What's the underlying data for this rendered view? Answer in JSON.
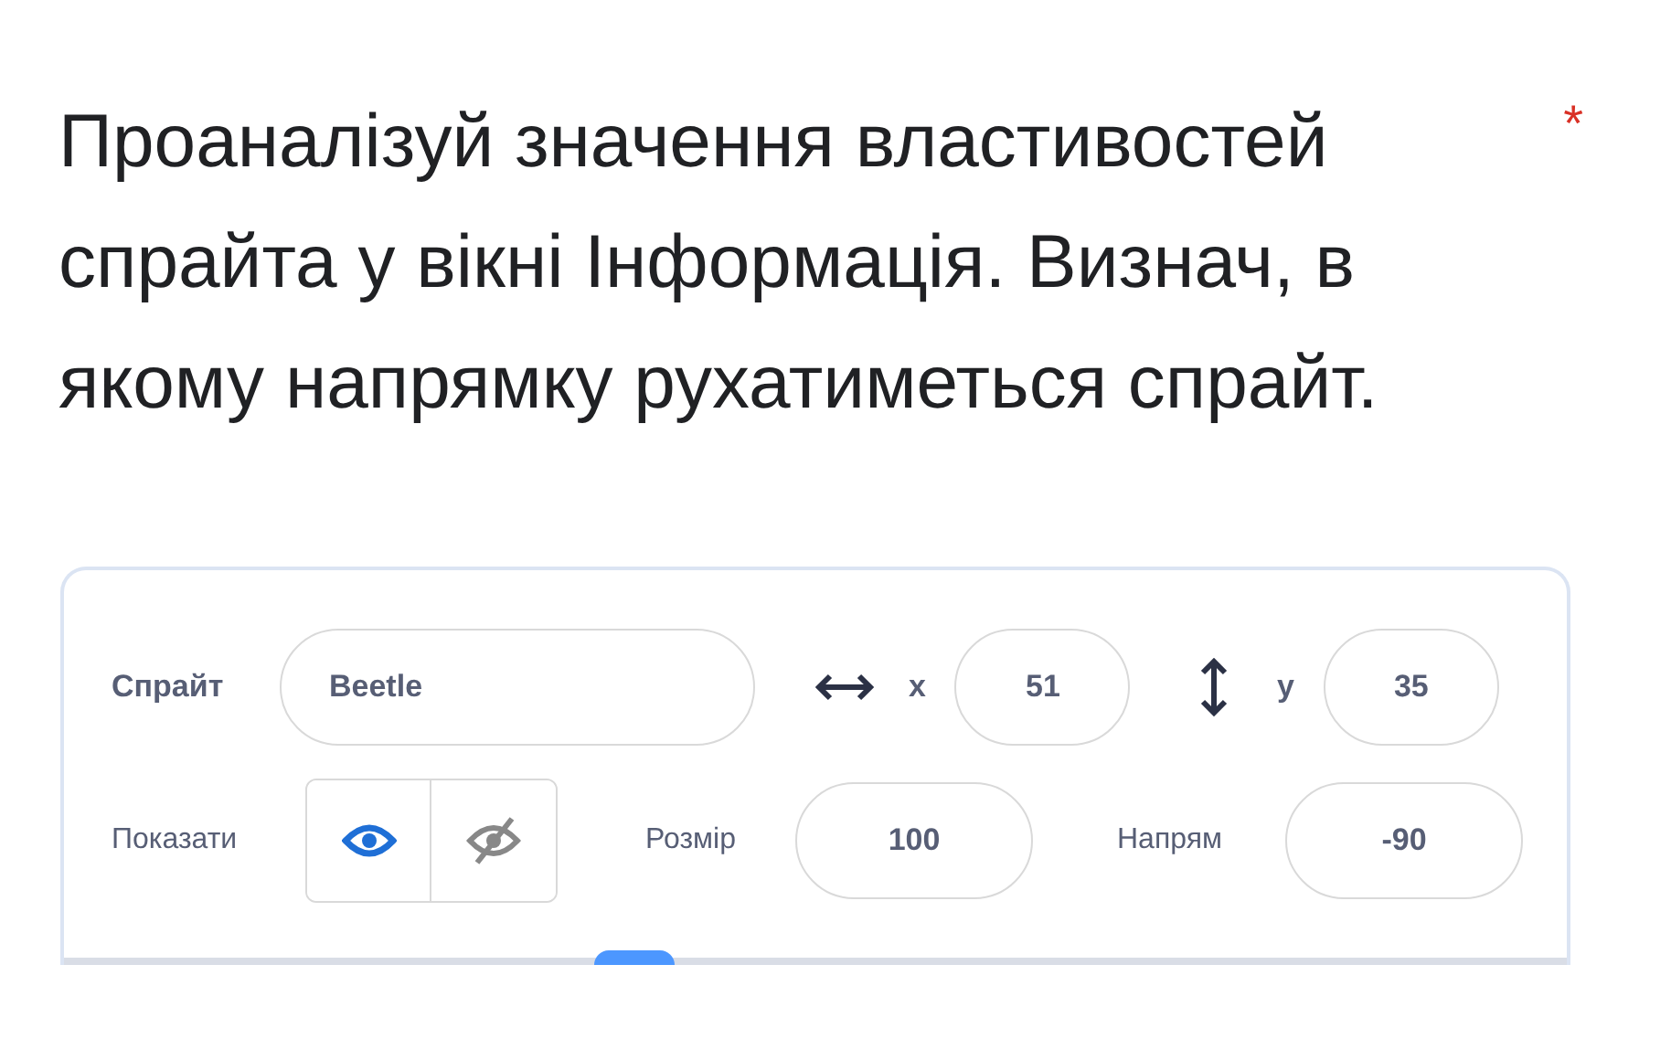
{
  "question": {
    "text": "Проаналізуй значення властивостей спрайта у вікні Інформація. Визнач, в якому напрямку рухатиметься спрайт.",
    "required_mark": "*"
  },
  "sprite_info": {
    "sprite_label": "Спрайт",
    "sprite_name": "Beetle",
    "x_label": "x",
    "x_value": "51",
    "y_label": "y",
    "y_value": "35",
    "show_label": "Показати",
    "visible": true,
    "size_label": "Розмір",
    "size_value": "100",
    "direction_label": "Напрям",
    "direction_value": "-90"
  }
}
